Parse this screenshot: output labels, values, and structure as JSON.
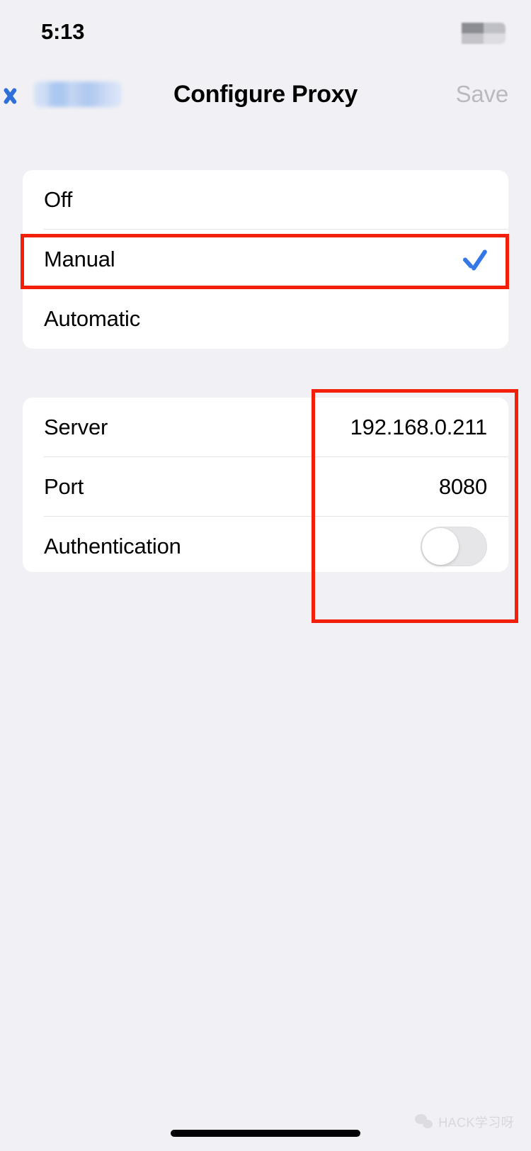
{
  "status_bar": {
    "time": "5:13",
    "right_indicators_redacted": true
  },
  "nav_bar": {
    "back_label_redacted": true,
    "back_icon": "chevron-left-icon",
    "title": "Configure Proxy",
    "save_label": "Save",
    "save_enabled": false
  },
  "groups": [
    {
      "id": "mode",
      "rows": [
        {
          "label": "Off",
          "selected": false
        },
        {
          "label": "Manual",
          "selected": true
        },
        {
          "label": "Automatic",
          "selected": false
        }
      ]
    },
    {
      "id": "proxy-fields",
      "rows": [
        {
          "label": "Server",
          "value": "192.168.0.211",
          "type": "text"
        },
        {
          "label": "Port",
          "value": "8080",
          "type": "text"
        },
        {
          "label": "Authentication",
          "value": "",
          "type": "toggle",
          "toggle_on": false
        }
      ]
    }
  ],
  "annotations": [
    {
      "name": "manual-row-highlight",
      "color": "#f41f09"
    },
    {
      "name": "proxy-values-highlight",
      "color": "#f41f09"
    }
  ],
  "watermark": {
    "text": "HACK学习呀",
    "icon": "wechat-icon"
  },
  "colors": {
    "background": "#f1f1f5",
    "card": "#ffffff",
    "accent_blue": "#3478e8",
    "back_blue": "#2f6fd8",
    "disabled_gray": "#b9b9c0",
    "separator": "#e3e3e6",
    "annotation_red": "#f41f09"
  }
}
